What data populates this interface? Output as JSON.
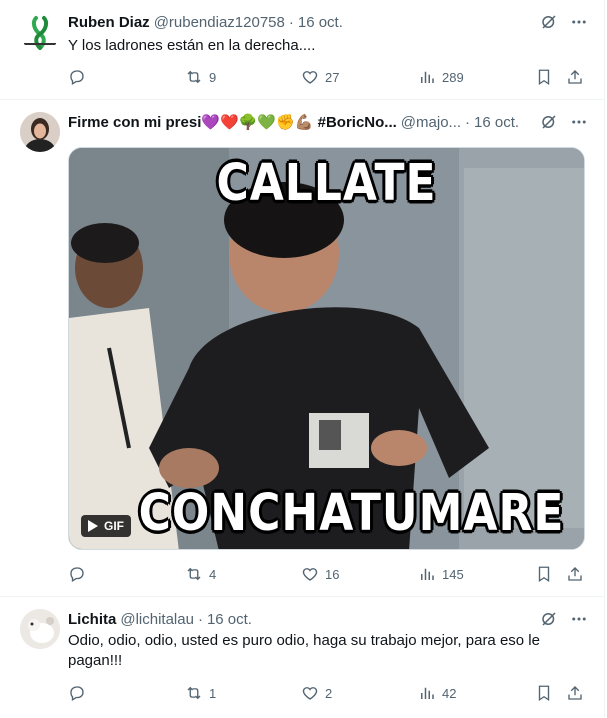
{
  "tweets": [
    {
      "name": "Ruben Diaz",
      "handle": "@rubendiaz120758",
      "sep": "·",
      "date": "16 oct.",
      "text": "Y los ladrones están en la derecha....",
      "retweets": "9",
      "likes": "27",
      "views": "289"
    },
    {
      "name": "Firme con mi presi💜❤️🌳💚✊💪🏽 #BoricNo...",
      "handle": "@majo...",
      "sep": "·",
      "date": "16 oct.",
      "media": {
        "caption_top": "CALLATE",
        "caption_bottom": "CONCHATUMARE",
        "badge": "GIF"
      },
      "retweets": "4",
      "likes": "16",
      "views": "145"
    },
    {
      "name": "Lichita",
      "handle": "@lichitalau",
      "sep": "·",
      "date": "16 oct.",
      "text": "Odio, odio, odio, usted es puro odio, haga su trabajo mejor, para eso le pagan!!!",
      "retweets": "1",
      "likes": "2",
      "views": "42"
    }
  ],
  "icons": {
    "reply": "reply-icon",
    "retweet": "retweet-icon",
    "like": "heart-icon",
    "views": "views-icon",
    "bookmark": "bookmark-icon",
    "share": "share-icon",
    "grok": "grok-icon",
    "more": "more-icon",
    "play": "play-icon"
  },
  "colors": {
    "text": "#0f1419",
    "muted": "#536471",
    "border": "#eff3f4"
  }
}
